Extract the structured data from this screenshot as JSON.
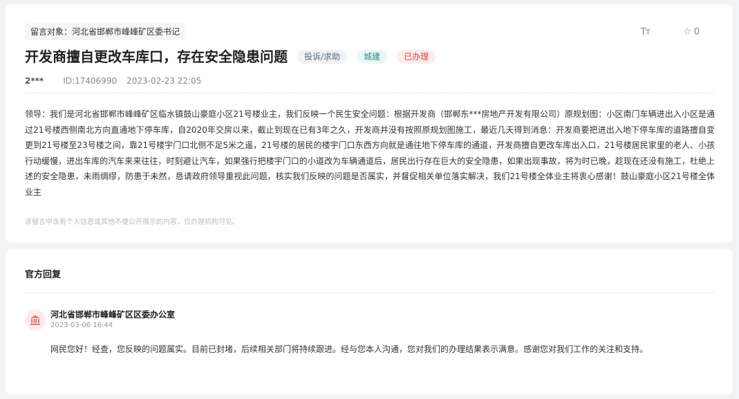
{
  "message": {
    "target_label": "留言对象：河北省邯郸市峰峰矿区委书记",
    "title": "开发商擅自更改车库口，存在安全隐患问题",
    "tags": {
      "type": "投诉/求助",
      "field": "城建",
      "status": "已办理"
    },
    "author": "2***",
    "id": "ID:17406990",
    "datetime": "2023-02-23 22:05",
    "star_count": "0",
    "font_size_icon": "Tт",
    "body": "领导：我们是河北省邯郸市峰峰矿区临水镇鼓山豪庭小区21号楼业主，我们反映一个民生安全问题：根据开发商（邯郸东***房地产开发有限公司）原规划图：小区南门车辆进出入小区是通过21号楼西侧南北方向直通地下停车库，自2020年交房以来，截止到现在已有3年之久，开发商并没有按照原规划图施工，最近几天得到消息：开发商要把进出入地下停车库的道路擅自变更到21号楼至23号楼之间，靠21号楼宇门口北侧不足5米之遥，21号楼的居民的楼宇门口东西方向就是通往地下停车库的通道，开发商擅自更改车库出入口，21号楼居民家里的老人、小孩行动缓慢，进出车库的汽车来来往往，时刻避让汽车，如果强行把楼宇门口的小道改为车辆通道后，居民出行存在巨大的安全隐患，如果出现事故，将为时已晚，趁现在还没有施工，杜绝上述的安全隐患，未雨绸缪，防患于未然，恳请政府领导重视此问题，核实我们反映的问题是否属实，并督促相关单位落实解决，我们21号楼全体业主将衷心感谢！鼓山豪庭小区21号楼全体业主",
    "privacy_note": "该留言中含有个人信息或其他不便公开展示的内容，仅办理机构可见。"
  },
  "reply": {
    "heading": "官方回复",
    "org_name": "河北省邯郸市峰峰矿区区委办公室",
    "datetime": "2023-03-06 16:44",
    "text": "网民您好！经查，您反映的问题属实。目前已封堵，后续相关部门将持续跟进。经与您本人沟通，您对我们的办理结果表示满意。感谢您对我们工作的关注和支持。",
    "avatar_icon": "government-building-icon"
  },
  "colors": {
    "status_red": "#d84646",
    "field_teal": "#2e8b85",
    "type_gray": "#5a6a80",
    "avatar_bg": "#fdeceb"
  }
}
